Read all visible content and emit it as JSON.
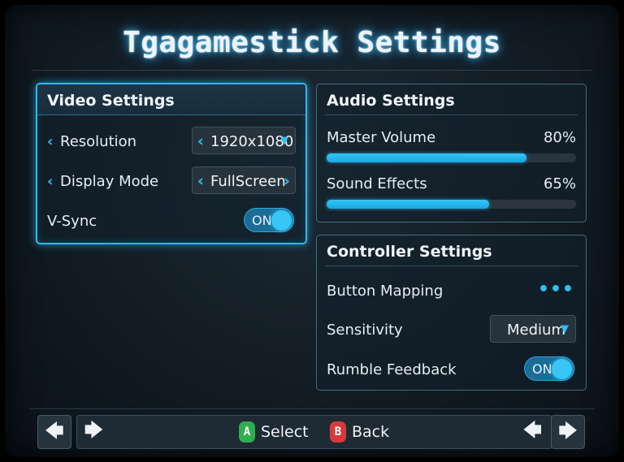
{
  "title": "Tgagamestick Settings",
  "video": {
    "heading": "Video Settings",
    "resolution_label": "Resolution",
    "resolution_value": "1920x1080",
    "display_mode_label": "Display Mode",
    "display_mode_value": "FullScreen",
    "vsync_label": "V-Sync",
    "vsync_state": "ON"
  },
  "audio": {
    "heading": "Audio Settings",
    "sliders": [
      {
        "label": "Master Volume",
        "value_text": "80%",
        "value": 80
      },
      {
        "label": "Sound Effects",
        "value_text": "65%",
        "value": 65
      }
    ]
  },
  "controller": {
    "heading": "Controller Settings",
    "button_mapping_label": "Button Mapping",
    "button_mapping_more": "•••",
    "sensitivity_label": "Sensitivity",
    "sensitivity_value": "Medium",
    "rumble_label": "Rumble Feedback",
    "rumble_state": "ON"
  },
  "footer": {
    "select_glyph": "A",
    "select_label": "Select",
    "back_glyph": "B",
    "back_label": "Back",
    "left_arrow": "🡄",
    "right_arrow": "🡆"
  },
  "colors": {
    "accent": "#2ec0f0",
    "a_button": "#2fae4f",
    "b_button": "#d63a3a"
  }
}
